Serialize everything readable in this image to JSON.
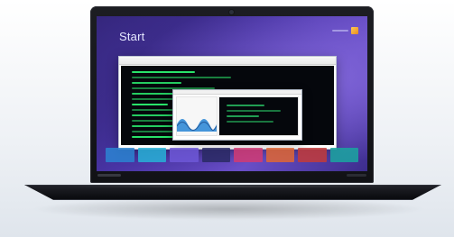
{
  "screen": {
    "start_title": "Start"
  },
  "colors": {
    "wallpaper_top": "#2a1f6a",
    "wallpaper_highlight": "#6a4fc8",
    "terminal_green": "#29e36a",
    "laptop_black": "#111216"
  },
  "icons": {
    "camera": "camera-icon"
  }
}
